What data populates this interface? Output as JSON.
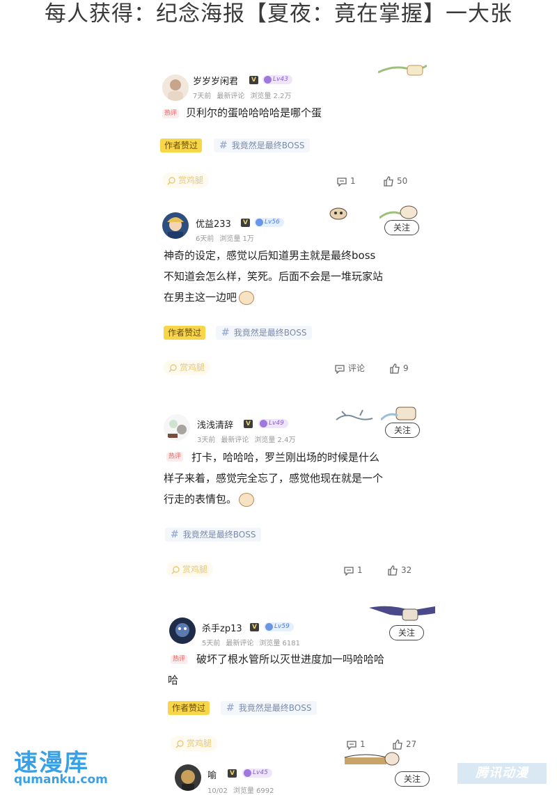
{
  "headline": "每人获得：纪念海报【夏夜：竟在掌握】一大张",
  "common": {
    "author_liked": "作者赞过",
    "topic": "我竟然是最终BOSS",
    "reward": "赏鸡腿",
    "follow": "关注",
    "verified_mark": "V",
    "hot": "热评"
  },
  "posts": [
    {
      "username": "岁岁岁闲君",
      "level": "Lv43",
      "level_color": "#8a5cd6",
      "time": "7天前",
      "sort": "最新评论",
      "views": "浏览量 2.2万",
      "hot": true,
      "lines": [
        "贝利尔的蛋哈哈哈哈是哪个蛋"
      ],
      "author_liked": true,
      "comments": "1",
      "likes": "50",
      "follow": false
    },
    {
      "username": "优益233",
      "level": "Lv56",
      "level_color": "#4b7fe0",
      "time": "6天前",
      "sort": "",
      "views": "浏览量 1万",
      "hot": false,
      "lines": [
        "神奇的设定，感觉以后知道男主就是最终boss",
        "不知道会怎么样，笑死。后面不会是一堆玩家站",
        "在男主这一边吧"
      ],
      "author_liked": true,
      "comments": "评论",
      "likes": "9",
      "follow": true
    },
    {
      "username": "浅浅清辞",
      "level": "Lv49",
      "level_color": "#8a5cd6",
      "time": "3天前",
      "sort": "最新评论",
      "views": "浏览量 2.4万",
      "hot": true,
      "lines": [
        "打卡，哈哈哈，罗兰刚出场的时候是什么",
        "样子来着，感觉完全忘了，感觉他现在就是一个",
        "行走的表情包。"
      ],
      "author_liked": false,
      "comments": "1",
      "likes": "32",
      "follow": true
    },
    {
      "username": "杀手zp13",
      "level": "Lv59",
      "level_color": "#4b7fe0",
      "time": "5天前",
      "sort": "最新评论",
      "views": "浏览量 6181",
      "hot": true,
      "lines": [
        "破坏了根水管所以灭世进度加一吗哈哈哈",
        "哈"
      ],
      "author_liked": true,
      "comments": "1",
      "likes": "27",
      "follow": true
    },
    {
      "username": "喻",
      "level": "Lv45",
      "level_color": "#8a5cd6",
      "time": "10/02",
      "sort": "",
      "views": "浏览量 6992",
      "follow": true
    }
  ],
  "watermarks": {
    "left_big": "速漫库",
    "left_small": "qumanku.com",
    "right": "腾讯动漫"
  }
}
